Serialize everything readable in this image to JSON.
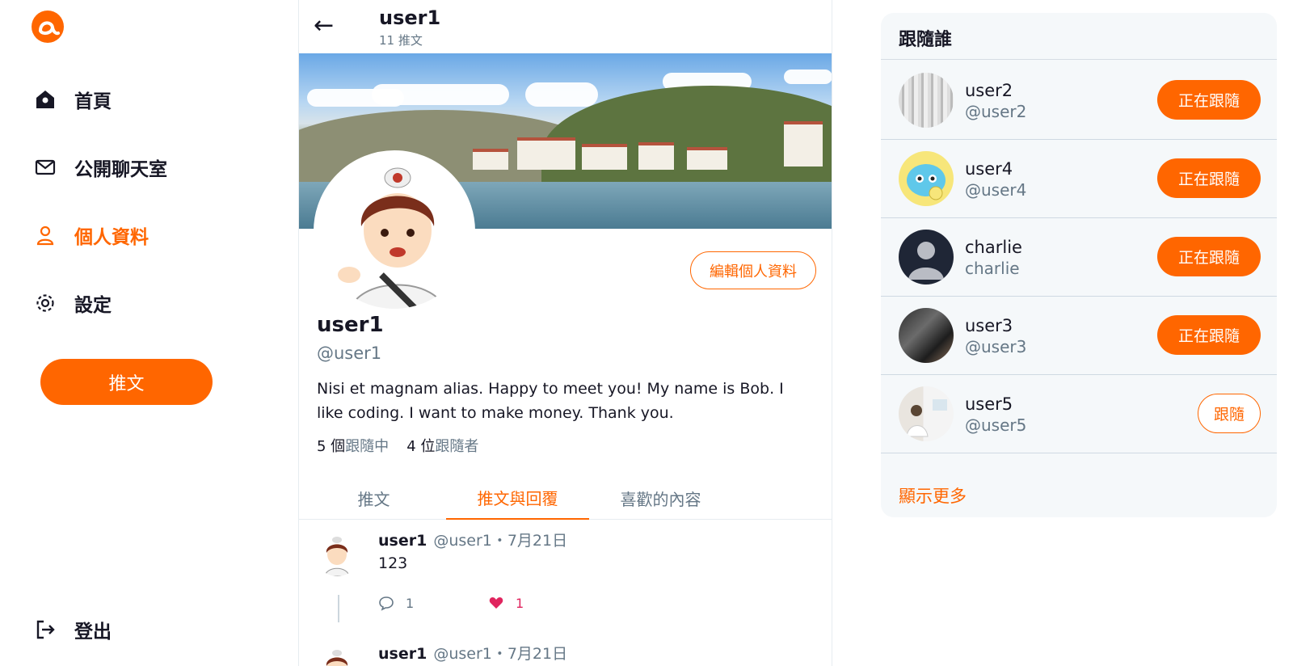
{
  "colors": {
    "accent": "#ff6600",
    "muted": "#657786",
    "like": "#e0245e",
    "panel_bg": "#f5f8fa"
  },
  "nav": {
    "items": [
      {
        "label": "首頁",
        "icon": "home-icon",
        "active": false
      },
      {
        "label": "公開聊天室",
        "icon": "mail-icon",
        "active": false
      },
      {
        "label": "個人資料",
        "icon": "user-icon",
        "active": true
      },
      {
        "label": "設定",
        "icon": "gear-icon",
        "active": false
      }
    ],
    "tweet_button": "推文",
    "logout": "登出"
  },
  "header": {
    "back_icon": "arrow-left-icon",
    "title": "user1",
    "subtitle": "11 推文"
  },
  "profile": {
    "edit_button": "編輯個人資料",
    "name": "user1",
    "handle": "@user1",
    "bio": "Nisi et magnam alias. Happy to meet you! My name is Bob. I like coding. I want to make money. Thank you.",
    "following_count": "5 個",
    "following_label": "跟隨中",
    "followers_count": "4 位",
    "followers_label": "跟隨者"
  },
  "tabs": [
    {
      "label": "推文",
      "active": false
    },
    {
      "label": "推文與回覆",
      "active": true
    },
    {
      "label": "喜歡的內容",
      "active": false
    }
  ],
  "tweets": [
    {
      "name": "user1",
      "meta": "@user1・7月21日",
      "body": "123",
      "reply_count": "1",
      "like_count": "1"
    },
    {
      "name": "user1",
      "meta": "@user1・7月21日",
      "body": "",
      "reply_count": "",
      "like_count": ""
    }
  ],
  "follow_panel": {
    "title": "跟隨誰",
    "users": [
      {
        "name": "user2",
        "handle": "@user2",
        "button": "正在跟隨",
        "following": true
      },
      {
        "name": "user4",
        "handle": "@user4",
        "button": "正在跟隨",
        "following": true
      },
      {
        "name": "charlie",
        "handle": "charlie",
        "button": "正在跟隨",
        "following": true
      },
      {
        "name": "user3",
        "handle": "@user3",
        "button": "正在跟隨",
        "following": true
      },
      {
        "name": "user5",
        "handle": "@user5",
        "button": "跟隨",
        "following": false
      }
    ],
    "show_more": "顯示更多"
  }
}
